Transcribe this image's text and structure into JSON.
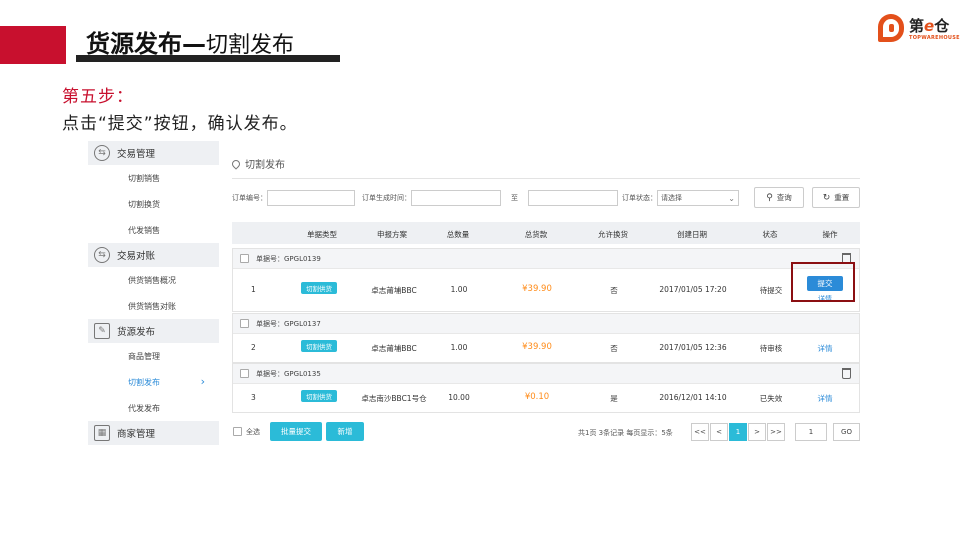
{
  "header": {
    "title_main": "货源发布",
    "title_dash": "—",
    "title_sub": "切割发布"
  },
  "logo": {
    "text_pre": "第",
    "text_e": "e",
    "text_post": "仓",
    "sub": "TOPWAREHOUSE"
  },
  "colors": {
    "accent_red": "#c8102e",
    "logo_orange": "#e3501b",
    "link_blue": "#2b8bd8",
    "tag_cyan": "#2bbbd8",
    "price_orange": "#ff8c1a"
  },
  "step": {
    "title": "第五步：",
    "desc": "点击“提交”按钮，确认发布。"
  },
  "sidebar": {
    "groups": [
      {
        "label": "交易管理",
        "icon": "exchange-icon",
        "items": [
          {
            "label": "切割销售"
          },
          {
            "label": "切割换货"
          },
          {
            "label": "代发销售"
          }
        ]
      },
      {
        "label": "交易对账",
        "icon": "exchange-icon",
        "items": [
          {
            "label": "供货销售概况"
          },
          {
            "label": "供货销售对账"
          }
        ]
      },
      {
        "label": "货源发布",
        "icon": "edit-icon",
        "items": [
          {
            "label": "商品管理"
          },
          {
            "label": "切割发布",
            "active": true
          },
          {
            "label": "代发发布"
          }
        ]
      },
      {
        "label": "商家管理",
        "icon": "store-icon",
        "items": []
      }
    ]
  },
  "main": {
    "title": "切割发布",
    "filters": {
      "order_no_label": "订单编号：",
      "created_label": "订单生成时间：",
      "to_label": "至",
      "status_label": "订单状态：",
      "status_value": "请选择",
      "search_button": "查询",
      "reset_button": "重置"
    },
    "columns": [
      "单据类型",
      "申报方案",
      "总数量",
      "总货款",
      "允许换货",
      "创建日期",
      "状态",
      "操作"
    ],
    "orders": [
      {
        "order_label": "单据号：GPGL0139",
        "index": "1",
        "type": "切割供货",
        "plan": "卓志莆埔BBC",
        "qty": "1.00",
        "amount": "¥39.90",
        "exchange": "否",
        "date": "2017/01/05 17:20",
        "status": "待提交",
        "action_submit": "提交",
        "action_detail": "详情"
      },
      {
        "order_label": "单据号：GPGL0137",
        "index": "2",
        "type": "切割供货",
        "plan": "卓志莆埔BBC",
        "qty": "1.00",
        "amount": "¥39.90",
        "exchange": "否",
        "date": "2017/01/05 12:36",
        "status": "待审核",
        "action_detail": "详情"
      },
      {
        "order_label": "单据号：GPGL0135",
        "index": "3",
        "type": "切割供货",
        "plan": "卓志南沙BBC1号仓",
        "qty": "10.00",
        "amount": "¥0.10",
        "exchange": "是",
        "date": "2016/12/01 14:10",
        "status": "已失效",
        "action_detail": "详情"
      }
    ],
    "footer": {
      "select_all": "全选",
      "batch_submit": "批量提交",
      "add": "新增",
      "summary": "共1页 3条记录 每页显示：5条",
      "first": "<<",
      "prev": "<",
      "current": "1",
      "next": ">",
      "last": ">>",
      "goto_value": "1",
      "go": "GO"
    }
  }
}
